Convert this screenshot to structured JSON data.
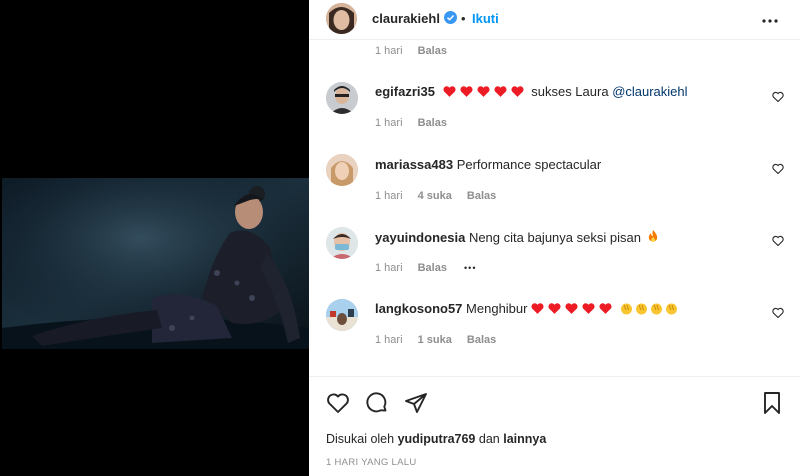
{
  "post": {
    "author": "claurakiehl",
    "follow_label": "Ikuti",
    "more_icon": "more-horizontal-icon"
  },
  "top_meta": {
    "time": "1 hari",
    "reply": "Balas"
  },
  "comments": [
    {
      "user": "egifazri35",
      "hearts": 5,
      "text": "sukses Laura",
      "mention": "@claurakiehl",
      "time": "1 hari",
      "likes": "",
      "reply": "Balas"
    },
    {
      "user": "mariassa483",
      "text": "Performance spectacular",
      "time": "1 hari",
      "likes": "4 suka",
      "reply": "Balas"
    },
    {
      "user": "yayuindonesia",
      "text": "Neng cita bajunya seksi pisan",
      "emoji": "fire",
      "time": "1 hari",
      "likes": "",
      "reply": "Balas",
      "more": "•••"
    },
    {
      "user": "langkosono57",
      "text": "Menghibur",
      "hearts": 5,
      "claps": 4,
      "time": "1 hari",
      "likes": "1 suka",
      "reply": "Balas"
    }
  ],
  "footer": {
    "liked_prefix": "Disukai oleh",
    "liked_user": "yudiputra769",
    "liked_mid": "dan",
    "liked_suffix": "lainnya",
    "date": "1 HARI YANG LALU"
  },
  "colors": {
    "accent": "#0095f6",
    "heart": "#ed1c24",
    "verified": "#3897f0"
  }
}
